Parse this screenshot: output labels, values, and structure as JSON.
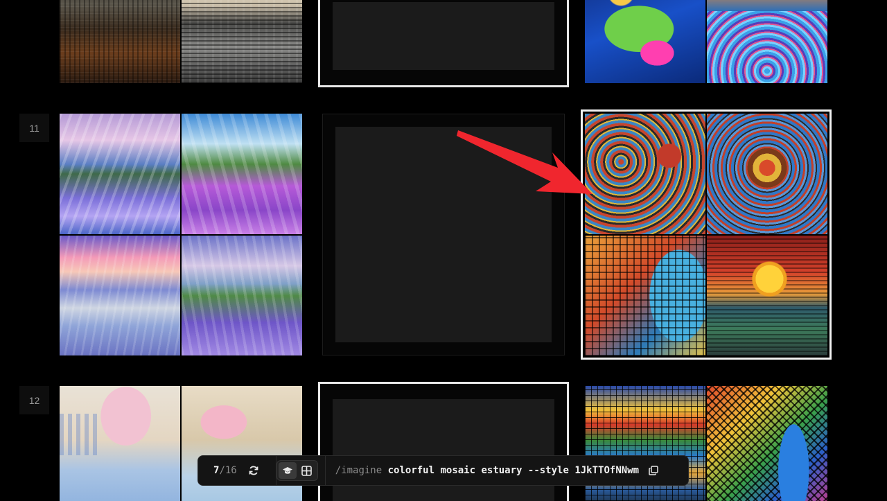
{
  "rows": [
    {
      "number": ""
    },
    {
      "number": "11"
    },
    {
      "number": "12"
    }
  ],
  "toolbar": {
    "current": "7",
    "separator": "/",
    "total": "16",
    "command": "/imagine",
    "prompt": " colorful mosaic estuary --style 1JkTTOfNNwm"
  },
  "icons": {
    "refresh": "refresh-icon",
    "graduation": "graduation-cap-icon",
    "grid": "grid-icon",
    "copy": "copy-icon",
    "arrow": "red-arrow-annotation"
  },
  "colors": {
    "background": "#000000",
    "placeholder": "#1b1b1b",
    "arrow": "#f0262e",
    "selection_border": "#f2f2f2"
  }
}
